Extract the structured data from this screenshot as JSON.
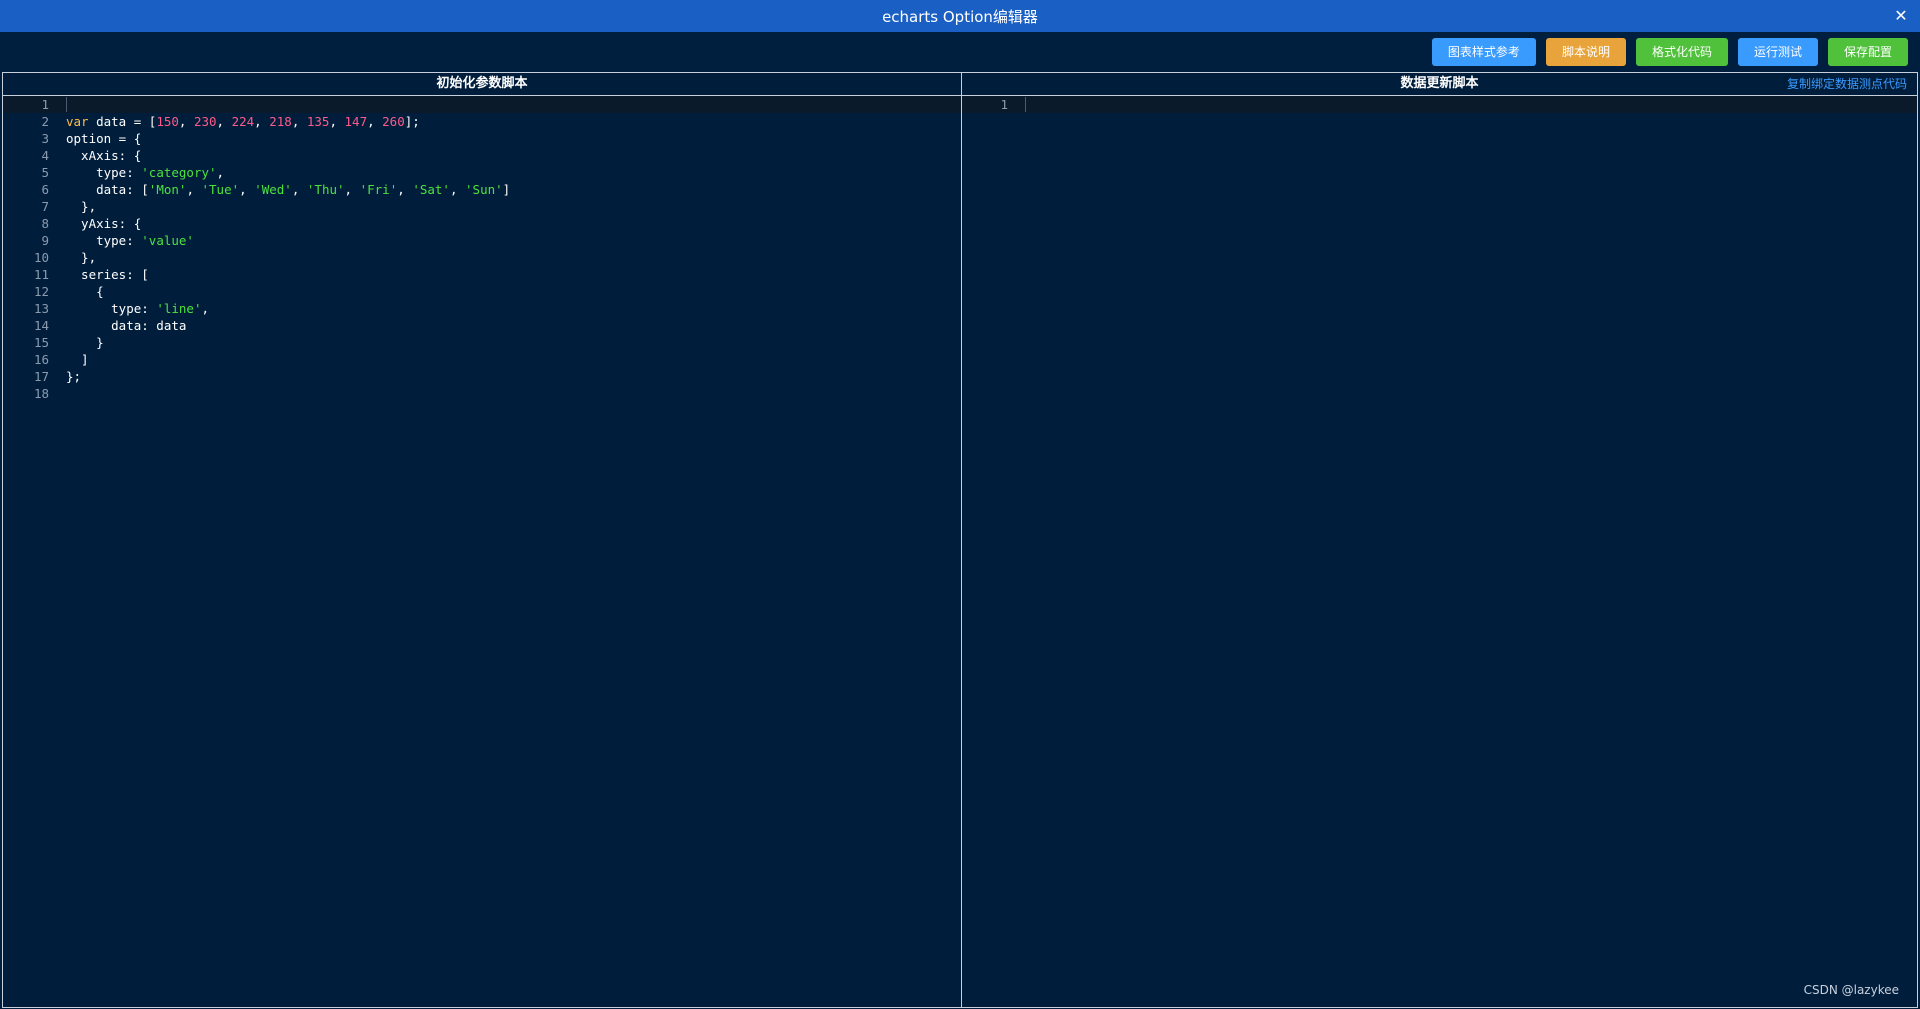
{
  "window": {
    "title": "echarts Option编辑器",
    "close_glyph": "✕"
  },
  "toolbar": {
    "buttons": [
      {
        "label": "图表样式参考",
        "color": "#3a9bff"
      },
      {
        "label": "脚本说明",
        "color": "#e8a43a"
      },
      {
        "label": "格式化代码",
        "color": "#4fc13a"
      },
      {
        "label": "运行测试",
        "color": "#3a9bff"
      },
      {
        "label": "保存配置",
        "color": "#4fc13a"
      }
    ]
  },
  "left_panel": {
    "title": "初始化参数脚本",
    "lines": [
      {
        "n": "1",
        "html": ""
      },
      {
        "n": "2",
        "html": "<span class='kw'>var</span> data = [<span class='num'>150</span>, <span class='num'>230</span>, <span class='num'>224</span>, <span class='num'>218</span>, <span class='num'>135</span>, <span class='num'>147</span>, <span class='num'>260</span>];"
      },
      {
        "n": "3",
        "html": "option = {"
      },
      {
        "n": "4",
        "html": "  xAxis: {"
      },
      {
        "n": "5",
        "html": "    type: <span class='str'>'category'</span>,"
      },
      {
        "n": "6",
        "html": "    data: [<span class='str'>'Mon'</span>, <span class='str'>'Tue'</span>, <span class='str'>'Wed'</span>, <span class='str'>'Thu'</span>, <span class='str'>'Fri'</span>, <span class='str'>'Sat'</span>, <span class='str'>'Sun'</span>]"
      },
      {
        "n": "7",
        "html": "  },"
      },
      {
        "n": "8",
        "html": "  yAxis: {"
      },
      {
        "n": "9",
        "html": "    type: <span class='str'>'value'</span>"
      },
      {
        "n": "10",
        "html": "  },"
      },
      {
        "n": "11",
        "html": "  series: ["
      },
      {
        "n": "12",
        "html": "    {"
      },
      {
        "n": "13",
        "html": "      type: <span class='str'>'line'</span>,"
      },
      {
        "n": "14",
        "html": "      data: data"
      },
      {
        "n": "15",
        "html": "    }"
      },
      {
        "n": "16",
        "html": "  ]"
      },
      {
        "n": "17",
        "html": "};"
      },
      {
        "n": "18",
        "html": ""
      }
    ]
  },
  "right_panel": {
    "title": "数据更新脚本",
    "copy_link": "复制绑定数据测点代码",
    "lines": [
      {
        "n": "1",
        "html": ""
      }
    ]
  },
  "footer": {
    "watermark": "CSDN @lazykee"
  }
}
